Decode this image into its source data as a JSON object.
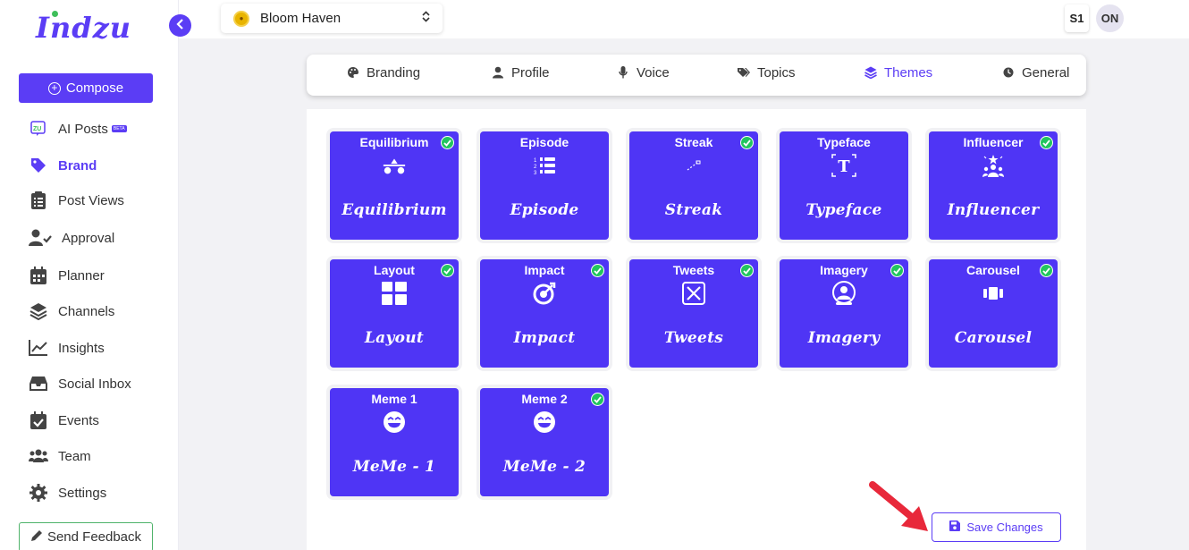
{
  "brand": {
    "logo_text": "Indzu"
  },
  "sidebar": {
    "compose_label": "Compose",
    "items": [
      {
        "label": "AI Posts",
        "icon": "ai-posts-icon",
        "badge": "BETA"
      },
      {
        "label": "Brand",
        "icon": "tag-icon",
        "active": true
      },
      {
        "label": "Post Views",
        "icon": "clipboard-list-icon"
      },
      {
        "label": "Approval",
        "icon": "user-check-icon"
      },
      {
        "label": "Planner",
        "icon": "calendar-icon"
      },
      {
        "label": "Channels",
        "icon": "layers-icon"
      },
      {
        "label": "Insights",
        "icon": "chart-line-icon"
      },
      {
        "label": "Social Inbox",
        "icon": "inbox-icon"
      },
      {
        "label": "Events",
        "icon": "calendar-check-icon"
      },
      {
        "label": "Team",
        "icon": "users-icon"
      },
      {
        "label": "Settings",
        "icon": "gear-icon"
      }
    ],
    "feedback_label": "Send Feedback"
  },
  "topbar": {
    "brand_name": "Bloom Haven",
    "user_initials_1": "S1",
    "user_initials_2": "ON"
  },
  "tabs": [
    {
      "label": "Branding",
      "icon": "palette-icon"
    },
    {
      "label": "Profile",
      "icon": "user-icon"
    },
    {
      "label": "Voice",
      "icon": "microphone-icon"
    },
    {
      "label": "Topics",
      "icon": "tags-icon"
    },
    {
      "label": "Themes",
      "icon": "layers-icon",
      "active": true
    },
    {
      "label": "General",
      "icon": "clock-icon"
    }
  ],
  "themes": [
    {
      "title": "Equilibrium",
      "script": "Equilibrium",
      "icon": "balance-icon",
      "selected": true
    },
    {
      "title": "Episode",
      "script": "Episode",
      "icon": "numbered-list-icon",
      "selected": false
    },
    {
      "title": "Streak",
      "script": "Streak",
      "icon": "streak-icon",
      "selected": true
    },
    {
      "title": "Typeface",
      "script": "Typeface",
      "icon": "typeface-icon",
      "selected": false
    },
    {
      "title": "Influencer",
      "script": "Influencer",
      "icon": "influencer-icon",
      "selected": true
    },
    {
      "title": "Layout",
      "script": "Layout",
      "icon": "layout-grid-icon",
      "selected": true
    },
    {
      "title": "Impact",
      "script": "Impact",
      "icon": "target-icon",
      "selected": true
    },
    {
      "title": "Tweets",
      "script": "Tweets",
      "icon": "x-logo-icon",
      "selected": true
    },
    {
      "title": "Imagery",
      "script": "Imagery",
      "icon": "portrait-icon",
      "selected": true
    },
    {
      "title": "Carousel",
      "script": "Carousel",
      "icon": "carousel-icon",
      "selected": true
    },
    {
      "title": "Meme 1",
      "script": "MeMe - 1",
      "icon": "laughing-face-icon",
      "selected": false
    },
    {
      "title": "Meme 2",
      "script": "MeMe - 2",
      "icon": "laughing-face-icon",
      "selected": true
    }
  ],
  "save_label": "Save Changes",
  "colors": {
    "accent": "#5b3df5",
    "card": "#4f35f5",
    "check": "#22c55e",
    "arrow": "#e8283a"
  }
}
